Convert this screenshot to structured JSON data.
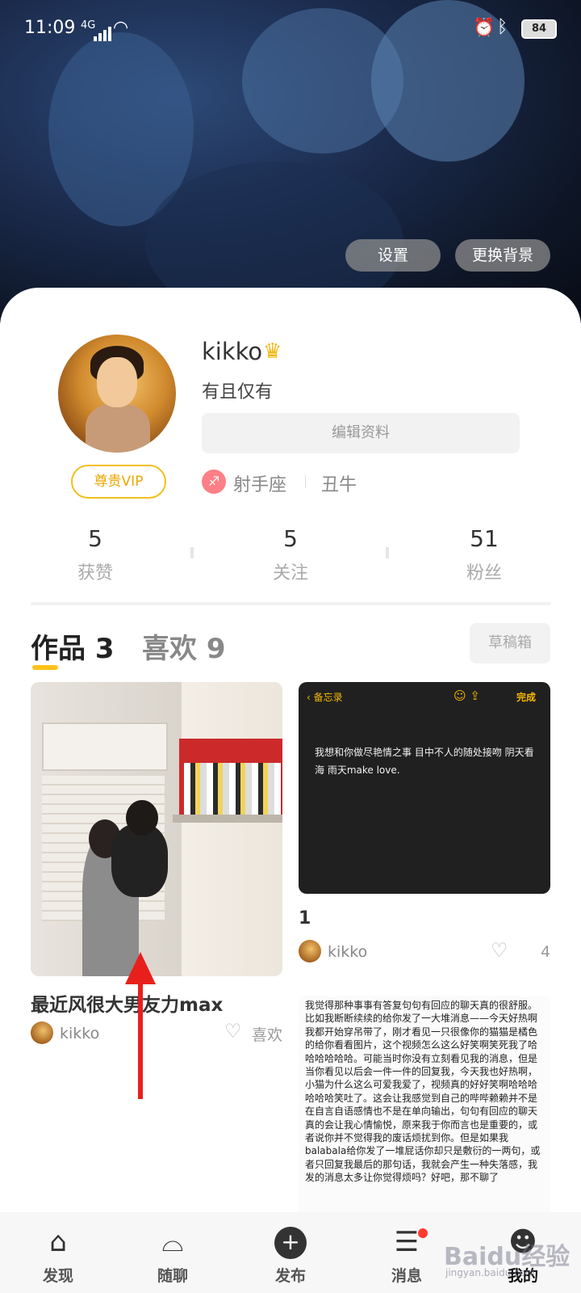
{
  "status_bar": {
    "time": "11:09",
    "network": "4G",
    "battery": "84"
  },
  "header": {
    "settings_label": "设置",
    "change_bg_label": "更换背景"
  },
  "profile": {
    "username": "kikko",
    "bio": "有且仅有",
    "edit_label": "编辑资料",
    "vip_label": "尊贵VIP",
    "zodiac": "射手座",
    "chinese_zodiac": "丑牛"
  },
  "stats": [
    {
      "value": "5",
      "label": "获赞"
    },
    {
      "value": "5",
      "label": "关注"
    },
    {
      "value": "51",
      "label": "粉丝"
    }
  ],
  "tabs": {
    "works": "作品 3",
    "likes": "喜欢 9",
    "drafts": "草稿箱"
  },
  "posts": [
    {
      "title": "最近风很大男友力max",
      "user": "kikko",
      "like_label": "喜欢"
    },
    {
      "memo_back": "备忘录",
      "memo_done": "完成",
      "memo_text": "我想和你做尽艳情之事  目中不人的随处接吻 阴天看海 雨天make love.",
      "title": "1",
      "user": "kikko",
      "likes": "4"
    },
    {
      "text": "我觉得那种事事有答复句句有回应的聊天真的很舒服。比如我断断续续的给你发了一大堆消息——今天好热啊我都开始穿吊带了，刚才看见一只很像你的猫猫是橘色的给你看看图片，这个视频怎么这么好笑啊笑死我了哈哈哈哈哈哈。可能当时你没有立刻看见我的消息，但是当你看见以后会一件一件的回复我，今天我也好热啊，小猫为什么这么可爱我爱了，视频真的好好笑啊哈哈哈哈哈哈笑吐了。这会让我感觉到自己的哔哔赖赖并不是在自言自语感情也不是在单向输出，句句有回应的聊天真的会让我心情愉悦，原来我于你而言也是重要的，或者说你并不觉得我的废话烦扰到你。但是如果我balabala给你发了一堆屁话你却只是敷衍的一两句，或者只回复我最后的那句话，我就会产生一种失落感，我发的消息太多让你觉得烦吗？好吧，那不聊了"
    }
  ],
  "nav": [
    {
      "label": "发现",
      "icon": "home-icon"
    },
    {
      "label": "随聊",
      "icon": "ghost-chat-icon"
    },
    {
      "label": "发布",
      "icon": "plus-circle-icon"
    },
    {
      "label": "消息",
      "icon": "message-icon"
    },
    {
      "label": "我的",
      "icon": "profile-icon"
    }
  ],
  "watermark": {
    "text": "Baidu经验",
    "sub": "jingyan.baidu.com"
  },
  "colors": {
    "accent": "#ffc21a",
    "vip": "#f2c01c",
    "badge": "#ff3b30",
    "annotation_arrow": "#e8201c"
  }
}
